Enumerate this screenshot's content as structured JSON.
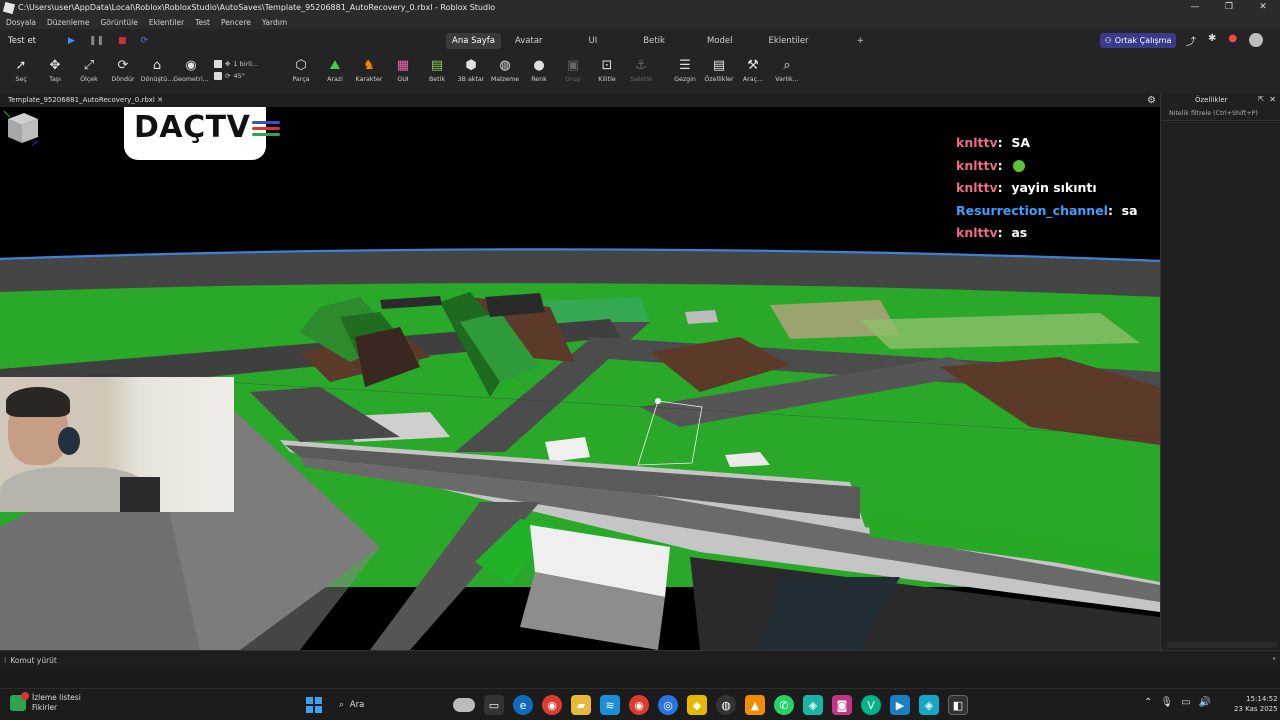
{
  "window": {
    "title": "C:\\Users\\user\\AppData\\Local\\Roblox\\RobloxStudio\\AutoSaves\\Template_95206881_AutoRecovery_0.rbxl - Roblox Studio",
    "minimize": "—",
    "maximize": "❐",
    "close": "✕"
  },
  "menu": [
    "Dosyala",
    "Düzenleme",
    "Görüntüle",
    "Eklentiler",
    "Test",
    "Pencere",
    "Yardım"
  ],
  "tabsbar": {
    "test_label": "Test et",
    "ribbon_tabs": [
      "Ana Sayfa",
      "Avatar",
      "UI",
      "Betik",
      "Model",
      "Eklentiler",
      "+"
    ],
    "active_tab": "Ana Sayfa",
    "collab_label": "Ortak Çalışma",
    "accent": "#3a3a8a"
  },
  "toolbar": {
    "tools_left": [
      {
        "label": "Seç",
        "icon": "select-cursor-icon"
      },
      {
        "label": "Taşı",
        "icon": "move-icon"
      },
      {
        "label": "Ölçek",
        "icon": "scale-icon"
      },
      {
        "label": "Döndür",
        "icon": "rotate-icon"
      },
      {
        "label": "Dönüştü...",
        "icon": "transform-icon"
      },
      {
        "label": "Geometri...",
        "icon": "geometry-icon"
      }
    ],
    "snap_move": "1 birli...",
    "snap_rotate": "45°",
    "tools_right": [
      {
        "label": "Parça",
        "icon": "part-icon"
      },
      {
        "label": "Arazi",
        "icon": "terrain-icon"
      },
      {
        "label": "Karakter",
        "icon": "character-icon"
      },
      {
        "label": "GUI",
        "icon": "gui-icon"
      },
      {
        "label": "Betik",
        "icon": "script-icon"
      },
      {
        "label": "3B aktar",
        "icon": "import-3d-icon"
      },
      {
        "label": "Malzeme",
        "icon": "material-icon"
      },
      {
        "label": "Renk",
        "icon": "color-icon"
      },
      {
        "label": "Grup",
        "icon": "group-icon"
      },
      {
        "label": "Kilitle",
        "icon": "lock-icon"
      },
      {
        "label": "Sabitle",
        "icon": "anchor-icon"
      },
      {
        "label": "Gezgin",
        "icon": "explorer-icon"
      },
      {
        "label": "Özellikler",
        "icon": "properties-icon"
      },
      {
        "label": "Araç...",
        "icon": "toolbox-icon"
      },
      {
        "label": "Varlık...",
        "icon": "asset-manager-icon"
      }
    ]
  },
  "document_tab": "Template_95206881_AutoRecovery_0.rbxl  ✕",
  "overlay": {
    "logo_text": "DAÇTV",
    "chat": [
      {
        "user": "knlttv",
        "message": "SA",
        "user_color": "#ef6a87"
      },
      {
        "user": "knlttv",
        "message": "",
        "emote": "green-emote",
        "user_color": "#ef6a87"
      },
      {
        "user": "knlttv",
        "message": "yayin sıkıntı",
        "user_color": "#ef6a87"
      },
      {
        "user": "Resurrection_channel",
        "message": "sa",
        "user_color": "#3aa0ff"
      },
      {
        "user": "knlttv",
        "message": "as",
        "user_color": "#ef6a87"
      }
    ]
  },
  "properties": {
    "title": "Özellikler",
    "filter_placeholder": "Nitelik filtrele (Ctrl+Shift+P)"
  },
  "command_bar": {
    "placeholder": "Komut yürüt"
  },
  "taskbar": {
    "watchlist_title": "İzleme listesi",
    "watchlist_subtitle": "Fikirler",
    "search_label": "Ara",
    "time": "15:14:52",
    "date": "23 Kas 2025"
  }
}
